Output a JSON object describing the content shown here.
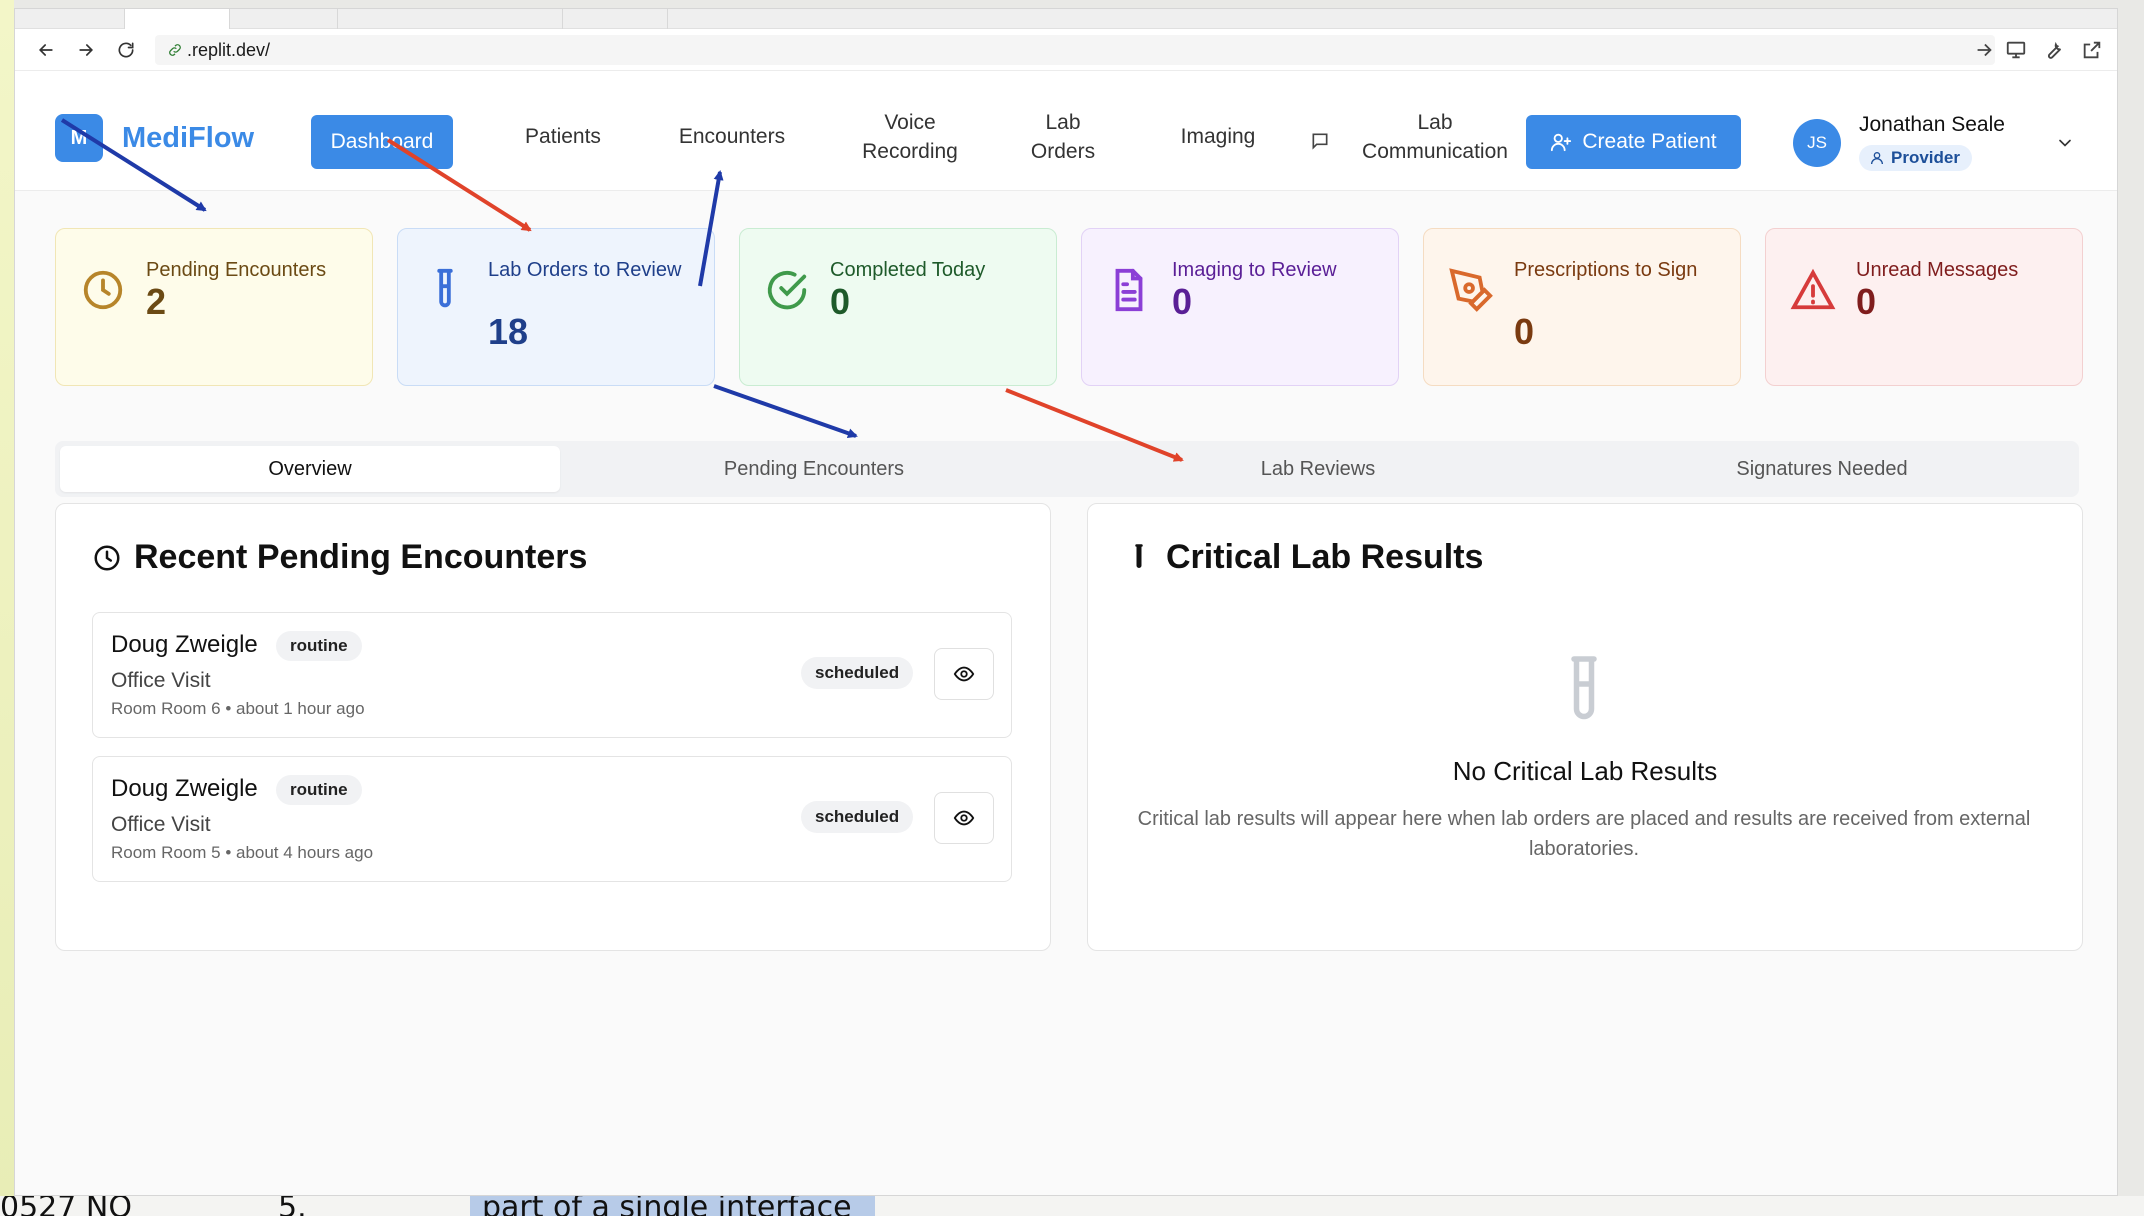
{
  "browser": {
    "url": ".replit.dev/"
  },
  "app": {
    "logo_letter": "M",
    "name": "MediFlow"
  },
  "nav": {
    "dashboard": "Dashboard",
    "patients": "Patients",
    "encounters": "Encounters",
    "voice_1": "Voice",
    "voice_2": "Recording",
    "lab_orders_1": "Lab",
    "lab_orders_2": "Orders",
    "imaging": "Imaging",
    "lab_comm_1": "Lab",
    "lab_comm_2": "Communication",
    "create_patient": "Create Patient"
  },
  "user": {
    "initials": "JS",
    "name": "Jonathan Seale",
    "role": "Provider"
  },
  "stats": [
    {
      "label": "Pending Encounters",
      "value": "2",
      "color": "#b7852a"
    },
    {
      "label": "Lab Orders to Review",
      "value": "18",
      "color": "#3b6fd8"
    },
    {
      "label": "Completed Today",
      "value": "0",
      "color": "#3f9a4b"
    },
    {
      "label": "Imaging to Review",
      "value": "0",
      "color": "#8b3fd6"
    },
    {
      "label": "Prescriptions to Sign",
      "value": "0",
      "color": "#d9692c"
    },
    {
      "label": "Unread Messages",
      "value": "0",
      "color": "#d63b3b"
    }
  ],
  "tabs": [
    "Overview",
    "Pending Encounters",
    "Lab Reviews",
    "Signatures Needed"
  ],
  "recent": {
    "title": "Recent Pending Encounters",
    "items": [
      {
        "name": "Doug Zweigle",
        "priority": "routine",
        "type": "Office Visit",
        "meta": "Room Room 6 • about 1 hour ago",
        "status": "scheduled"
      },
      {
        "name": "Doug Zweigle",
        "priority": "routine",
        "type": "Office Visit",
        "meta": "Room Room 5 • about 4 hours ago",
        "status": "scheduled"
      }
    ]
  },
  "critical": {
    "title": "Critical Lab Results",
    "empty_title": "No Critical Lab Results",
    "empty_text": "Critical lab results will appear here when lab orders are placed and results are received from external laboratories."
  },
  "background_text": {
    "col1": "0527 NO",
    "col2": "5.",
    "col3": "part of a single interface"
  }
}
